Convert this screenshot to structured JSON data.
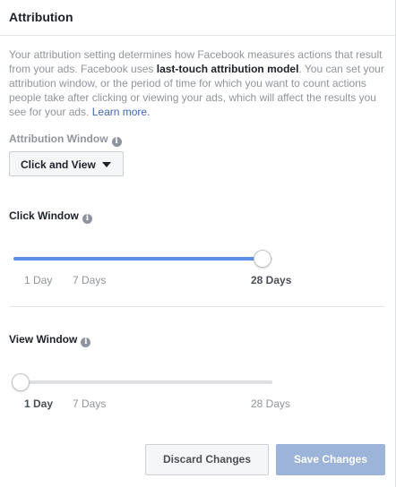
{
  "header": {
    "title": "Attribution"
  },
  "description": {
    "part1": "Your attribution setting determines how Facebook measures actions that result from your ads. Facebook uses ",
    "bold": "last-touch attribution model",
    "part2": ". You can set your attribution window, or the period of time for which you want to count actions people take after clicking or viewing your ads, which will affect the results you see for your ads. ",
    "link": "Learn more."
  },
  "attribution_window": {
    "label": "Attribution Window",
    "selected": "Click and View"
  },
  "click_window": {
    "label": "Click Window",
    "ticks": [
      "1 Day",
      "7 Days",
      "28 Days"
    ],
    "selected": "28 Days",
    "fill_percent": 100
  },
  "view_window": {
    "label": "View Window",
    "ticks": [
      "1 Day",
      "7 Days",
      "28 Days"
    ],
    "selected": "1 Day",
    "fill_percent": 0
  },
  "buttons": {
    "discard": "Discard Changes",
    "save": "Save Changes"
  },
  "colors": {
    "accent": "#5b8fe8",
    "link": "#4267b2",
    "save_disabled": "#9cb4d8"
  }
}
